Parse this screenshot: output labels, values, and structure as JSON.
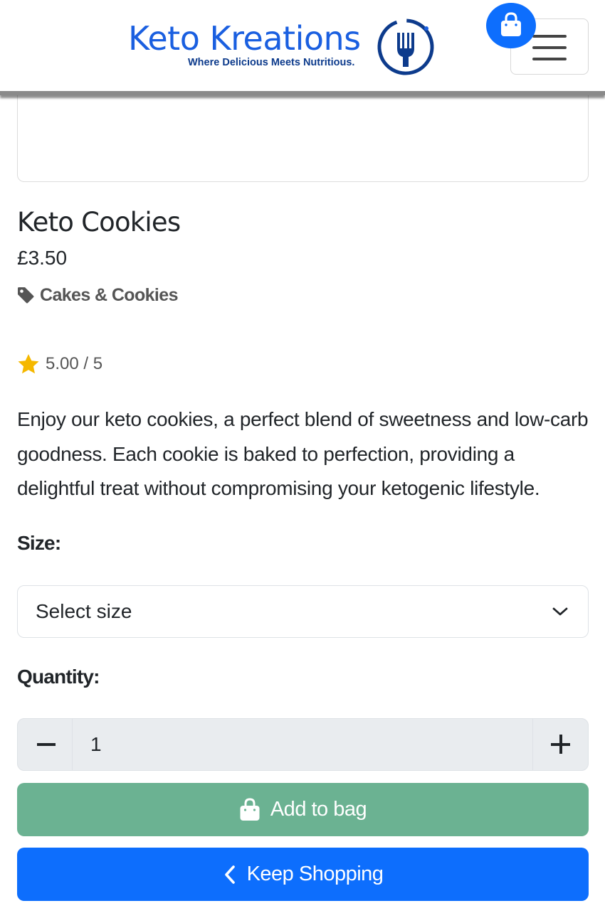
{
  "header": {
    "logo_title": "Keto Kreations",
    "logo_tagline": "Where Delicious Meets Nutritious.",
    "brand_color": "#1a5fe0",
    "bag_icon": "shopping-bag-icon",
    "menu_icon": "hamburger-menu-icon"
  },
  "product": {
    "title": "Keto Cookies",
    "price": "£3.50",
    "category_icon": "tag-icon",
    "category": "Cakes & Cookies",
    "rating_icon": "star-icon",
    "rating": "5.00 / 5",
    "description": "Enjoy our keto cookies, a perfect blend of sweetness and low-carb goodness. Each cookie is baked to perfection, providing a delightful treat without compromising your ketogenic lifestyle."
  },
  "form": {
    "size_label": "Size:",
    "size_selected": "Select size",
    "quantity_label": "Quantity:",
    "quantity_value": "1"
  },
  "buttons": {
    "add_to_bag": "Add to bag",
    "add_to_bag_color": "#6bb292",
    "keep_shopping": "Keep Shopping",
    "keep_shopping_color": "#0d6efd"
  }
}
